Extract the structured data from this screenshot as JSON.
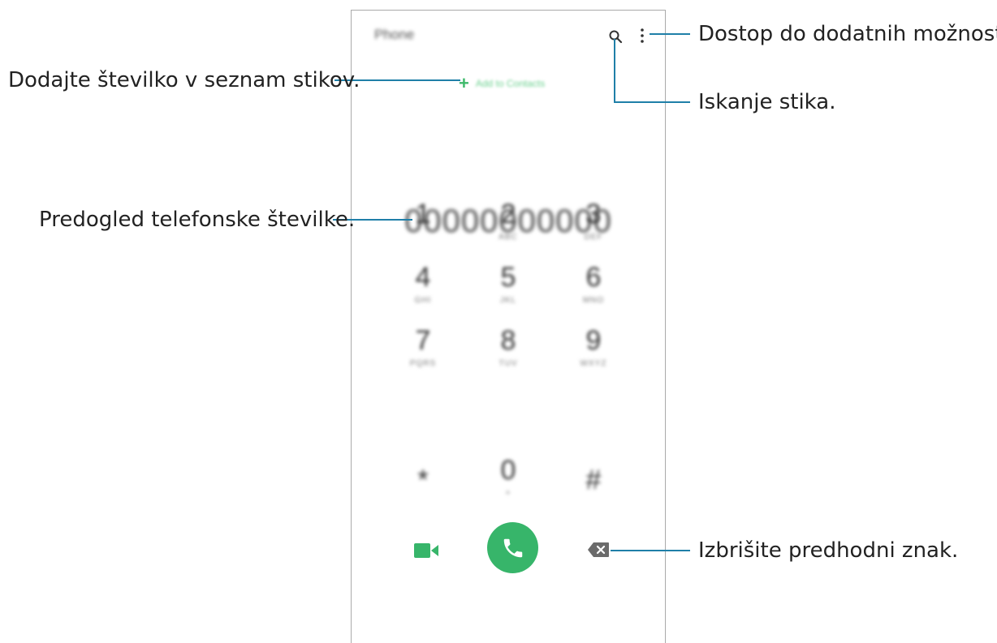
{
  "app": {
    "title": "Phone",
    "add_to_contacts_label": "Add to Contacts",
    "number_preview": "00000000000",
    "keypad": [
      {
        "digit": "1",
        "letters": "",
        "name": "key-1"
      },
      {
        "digit": "2",
        "letters": "ABC",
        "name": "key-2"
      },
      {
        "digit": "3",
        "letters": "DEF",
        "name": "key-3"
      },
      {
        "digit": "4",
        "letters": "GHI",
        "name": "key-4"
      },
      {
        "digit": "5",
        "letters": "JKL",
        "name": "key-5"
      },
      {
        "digit": "6",
        "letters": "MNO",
        "name": "key-6"
      },
      {
        "digit": "7",
        "letters": "PQRS",
        "name": "key-7"
      },
      {
        "digit": "8",
        "letters": "TUV",
        "name": "key-8"
      },
      {
        "digit": "9",
        "letters": "WXYZ",
        "name": "key-9"
      },
      {
        "digit": "*",
        "letters": "",
        "name": "key-star"
      },
      {
        "digit": "0",
        "letters": "+",
        "name": "key-0"
      },
      {
        "digit": "#",
        "letters": "",
        "name": "key-hash"
      }
    ],
    "icons": {
      "search": "search-icon",
      "more": "more-options-icon",
      "add": "plus-icon",
      "video": "video-call-icon",
      "call": "phone-icon",
      "backspace": "backspace-icon"
    },
    "colors": {
      "accent_green": "#37b56a",
      "leader_line": "#1f7fa8"
    }
  },
  "callouts": {
    "more_options": "Dostop do dodatnih možnosti.",
    "add_number": "Dodajte številko v seznam stikov.",
    "search_contact": "Iskanje stika.",
    "number_preview": "Predogled telefonske številke.",
    "delete_char": "Izbrišite predhodni znak."
  }
}
